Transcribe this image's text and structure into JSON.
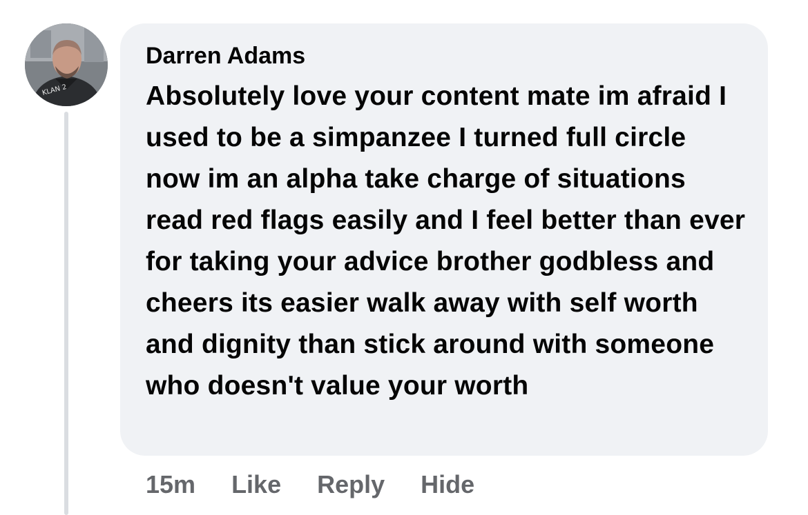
{
  "comment": {
    "author": "Darren Adams",
    "avatar_icon": "profile-photo",
    "text": "Absolutely love your content mate im afraid I used to be a simpanzee I turned full circle now im an alpha take charge of situations read red flags easily and I feel better than ever for taking your advice brother godbless and cheers its easier walk away with self worth and dignity than stick around with someone who doesn't value your worth",
    "timestamp": "15m",
    "actions": {
      "like": "Like",
      "reply": "Reply",
      "hide": "Hide"
    }
  },
  "colors": {
    "bubble_background": "#f0f2f5",
    "text": "#050505",
    "secondary_text": "#65676b",
    "thread_line": "#dadde1"
  }
}
